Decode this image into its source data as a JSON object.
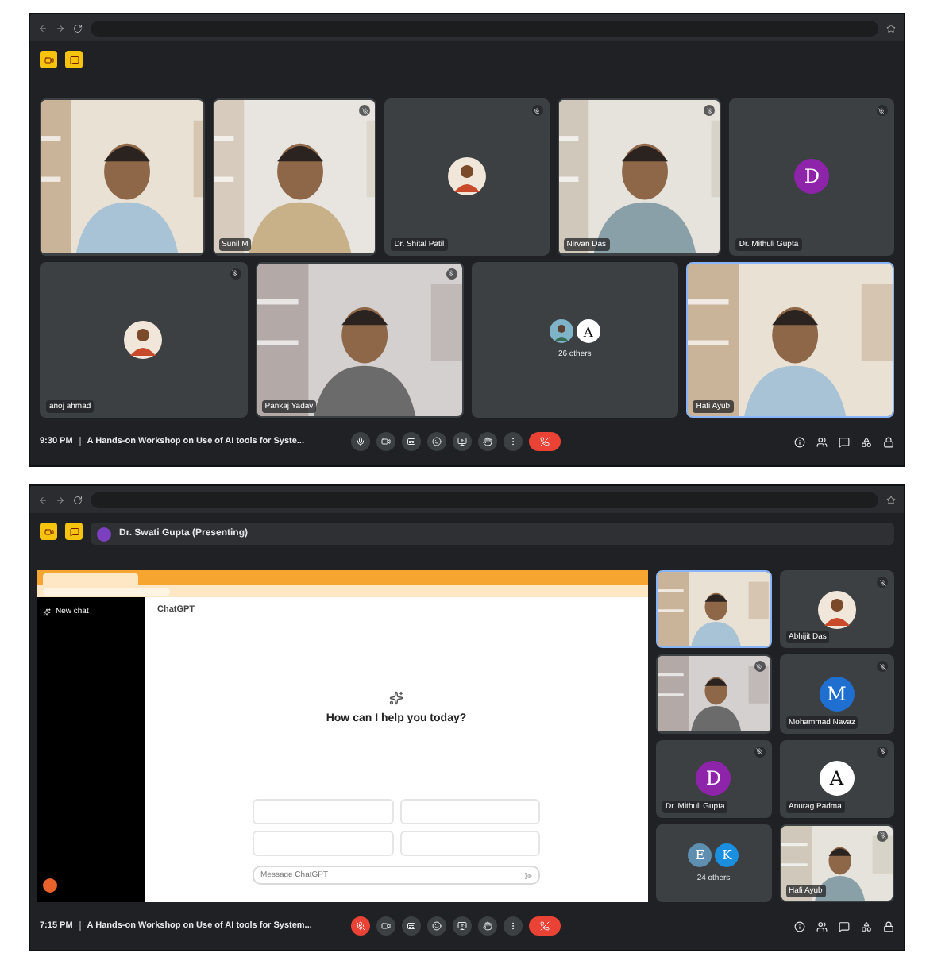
{
  "screens": [
    {
      "kind": "grid",
      "mic_muted": false,
      "time": "9:30 PM",
      "meeting": "A Hands-on Workshop on Use of AI tools for Syste...",
      "tile_rows": [
        [
          {
            "kind": "video",
            "muted": false,
            "speaking": false
          },
          {
            "kind": "video",
            "name": "Sunil M",
            "muted": true,
            "speaking": false
          },
          {
            "name": "Dr. Shital Patil",
            "muted": true,
            "speaking": false
          },
          {
            "kind": "video",
            "name": "Nirvan Das",
            "muted": true,
            "speaking": false
          },
          {
            "kind": "letter",
            "letter": "D",
            "color": "#8e24aa",
            "name": "Dr. Mithuli Gupta",
            "muted": true,
            "speaking": false
          }
        ],
        [
          {
            "name": "anoj ahmad",
            "muted": true,
            "speaking": false
          },
          {
            "kind": "video",
            "name": "Pankaj Yadav",
            "muted": true,
            "speaking": false
          },
          {
            "kind": "others",
            "name": "26 others",
            "avatars": [
              {
                "color": "#7fb3c8"
              },
              {
                "letter": "A",
                "color": "#ffffff"
              }
            ],
            "muted": false,
            "speaking": false
          },
          {
            "kind": "video",
            "name": "Hafi Ayub",
            "muted": false,
            "speaking": true
          }
        ]
      ]
    },
    {
      "kind": "presenting",
      "presenter": "Dr. Swati Gupta (Presenting)",
      "mic_muted": true,
      "time": "7:15 PM",
      "meeting": "A Hands-on Workshop on Use of AI tools for System...",
      "presentation": {
        "app_title": "ChatGPT",
        "new_chat": "New chat",
        "greeting": "How can I help you today?",
        "placeholder": "Message ChatGPT"
      },
      "tile_rows": [
        [
          {
            "kind": "video",
            "muted": false,
            "speaking": true
          },
          {
            "name": "Abhijit Das",
            "muted": true,
            "speaking": false
          }
        ],
        [
          {
            "kind": "video",
            "muted": true,
            "speaking": false
          },
          {
            "kind": "letter",
            "letter": "M",
            "color": "#1e6fd0",
            "name": "Mohammad Navaz",
            "muted": true,
            "speaking": false
          }
        ],
        [
          {
            "kind": "letter",
            "letter": "D",
            "color": "#8e24aa",
            "name": "Dr. Mithuli Gupta",
            "muted": true,
            "speaking": false
          },
          {
            "kind": "letter",
            "letter": "A",
            "color": "#ffffff",
            "name": "Anurag Padma",
            "muted": true,
            "speaking": false
          }
        ],
        [
          {
            "kind": "others",
            "name": "24 others",
            "avatars": [
              {
                "letter": "E",
                "color": "#5f8fb0"
              },
              {
                "letter": "K",
                "color": "#1a8fe0"
              }
            ],
            "muted": false,
            "speaking": false
          },
          {
            "kind": "video",
            "name": "Hafi Ayub",
            "muted": true,
            "speaking": false
          }
        ]
      ]
    }
  ]
}
